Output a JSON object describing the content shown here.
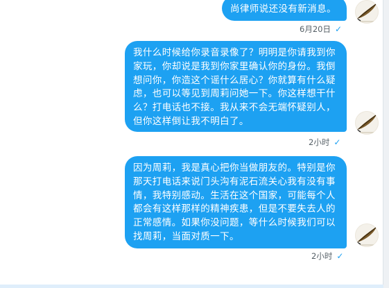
{
  "messages": [
    {
      "text": "尚律师说还没有新消息。",
      "time": "6月20日",
      "read_mark": "✓"
    },
    {
      "text": "我什么时候给你录音录像了？明明是你请我到你家玩，你却说是我到你家里确认你的身份。我倒想问你，你造这个谣什么居心？你就算有什么疑虑，也可以等见到周莉问她一下。你这样想干什么？打电话也不接。我从来不会无端怀疑别人，但你这样倒让我不明白了。",
      "time": "2小时",
      "read_mark": "✓"
    },
    {
      "text": "因为周莉，我是真心把你当做朋友的。特别是你那天打电话来说门头沟有泥石流关心我有没有事情，我特别感动。生活在这个国家，可能每个人都会有这样那样的精神疾患，但是不要失去人的正常感情。如果你没问题，等什么时候我们可以找周莉，当面对质一下。",
      "time": "2小时",
      "read_mark": "✓"
    }
  ],
  "avatar": {
    "icon": "quill-pen-icon",
    "background": "#f4f1ea"
  },
  "colors": {
    "bubble": "#1da1f2",
    "bubble_text": "#ffffff",
    "meta_text": "#555f66",
    "check": "#1da1f2"
  }
}
